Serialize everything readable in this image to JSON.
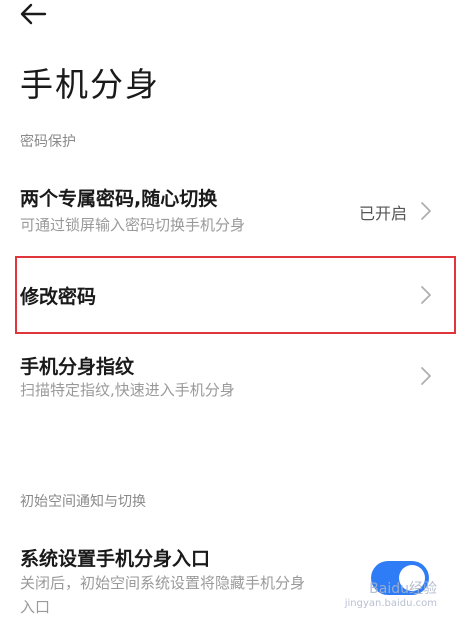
{
  "header": {
    "title": "手机分身"
  },
  "sections": [
    {
      "label": "密码保护"
    },
    {
      "label": "初始空间通知与切换"
    }
  ],
  "rows": {
    "dual_password": {
      "title": "两个专属密码,随心切换",
      "subtitle": "可通过锁屏输入密码切换手机分身",
      "status": "已开启"
    },
    "change_password": {
      "title": "修改密码"
    },
    "fingerprint": {
      "title": "手机分身指纹",
      "subtitle": "扫描特定指纹,快速进入手机分身"
    },
    "settings_entry": {
      "title": "系统设置手机分身入口",
      "subtitle_line1": "关闭后，初始空间系统设置将隐藏手机分身",
      "subtitle_line2": "入口",
      "toggle_on": true
    }
  },
  "watermark": {
    "text": "Baidu经验",
    "sub": "jingyan.baidu.com"
  },
  "colors": {
    "accent": "#2f7df6",
    "highlight": "#e0353b"
  }
}
